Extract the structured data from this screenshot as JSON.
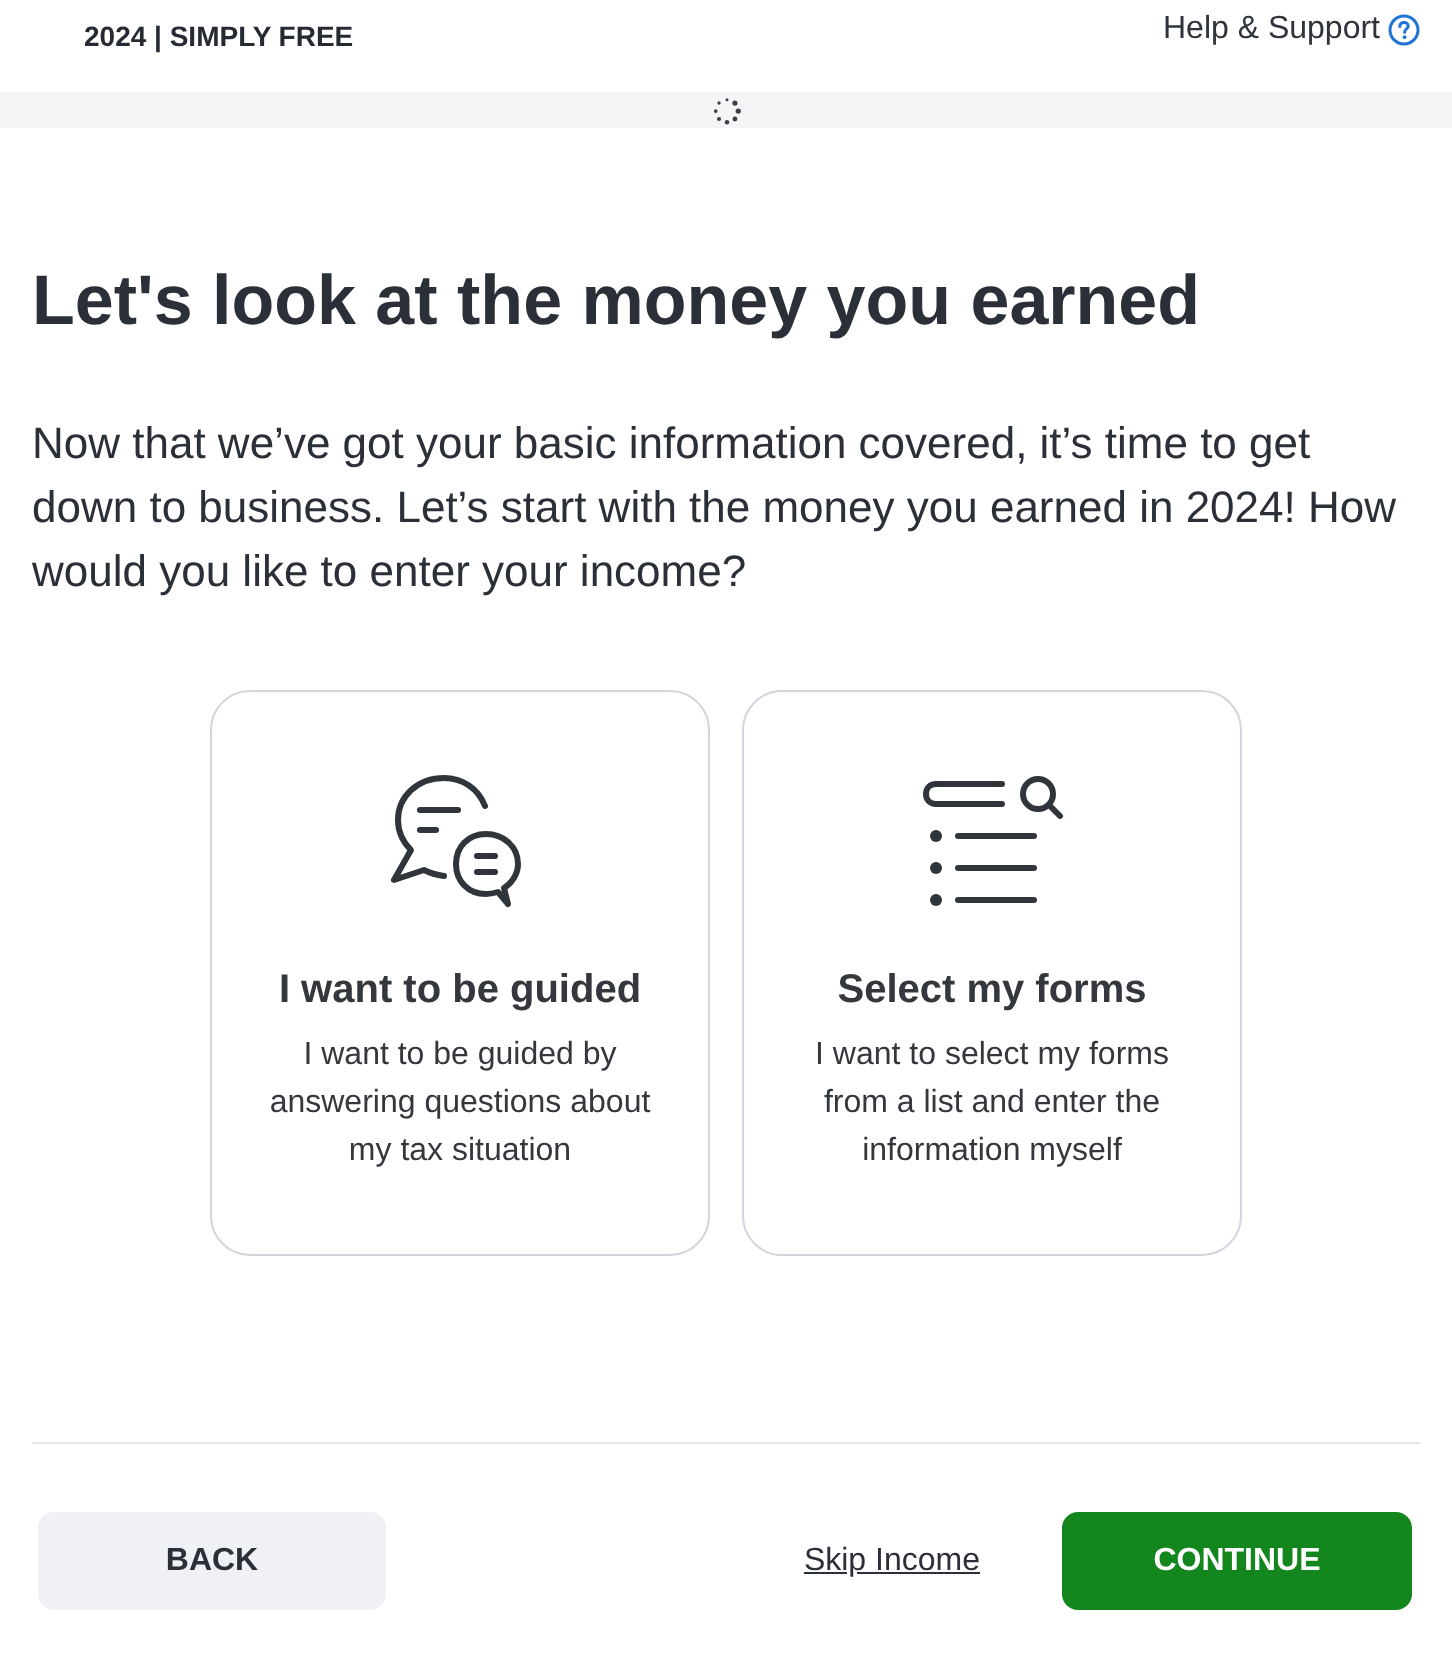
{
  "header": {
    "brand": "2024 | SIMPLY FREE",
    "help_link": "Help & Support"
  },
  "heading": "Let's look at the money you earned",
  "intro": "Now that we’ve got your basic information covered, it’s time to get down to business. Let’s start with the money you earned in 2024! How would you like to enter your income?",
  "options": [
    {
      "kind": "guided",
      "title": "I want to be guided",
      "description": "I want to be guided by answering questions about my tax situation"
    },
    {
      "kind": "forms",
      "title": "Select my forms",
      "description": "I want to select my forms from a list and enter the information myself"
    }
  ],
  "footer": {
    "back": "BACK",
    "skip": "Skip Income",
    "continue": "CONTINUE"
  }
}
